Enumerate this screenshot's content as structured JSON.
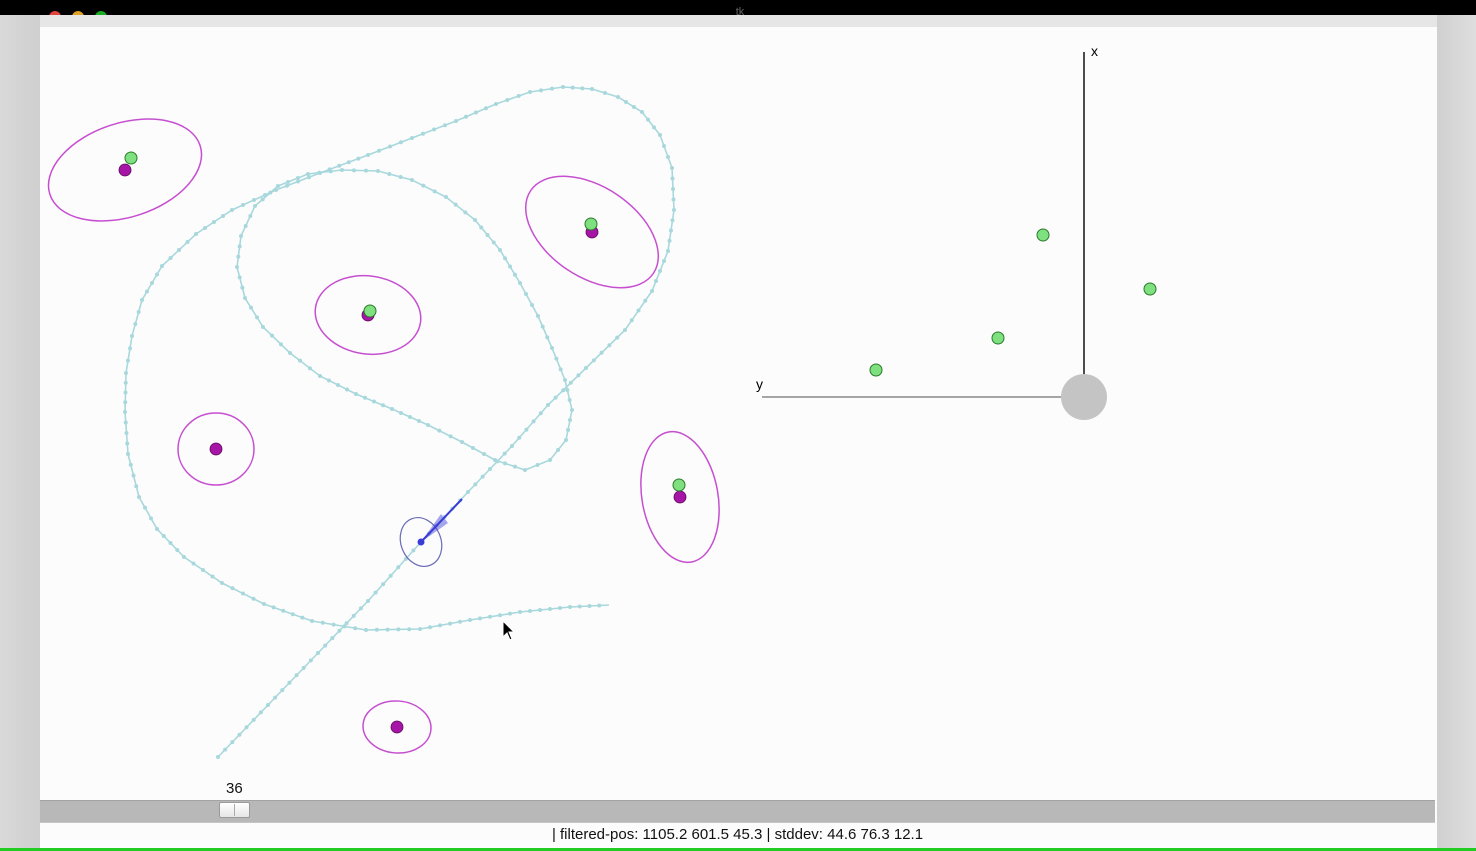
{
  "window": {
    "title": "tk"
  },
  "colors": {
    "ellipse": "#c64fd0",
    "landmark_true": "#7fe07f",
    "landmark_est": "#a615a6",
    "trajectory": "#a8d8dc",
    "robot": "#3b3bd6",
    "robot_ellipse": "#6a6ab8",
    "axis": "#111111",
    "axis_y": "#888888",
    "origin": "#c4c4c4"
  },
  "scene": {
    "landmarks": [
      {
        "true": [
          131,
          158
        ],
        "est": [
          125,
          170
        ],
        "ellipse": {
          "c": [
            125,
            170
          ],
          "rx": 79,
          "ry": 47,
          "rot": -18
        }
      },
      {
        "true": [
          591,
          224
        ],
        "est": [
          592,
          232
        ],
        "ellipse": {
          "c": [
            592,
            232
          ],
          "rx": 74,
          "ry": 45,
          "rot": 34
        }
      },
      {
        "true": [
          370,
          311
        ],
        "est": [
          368,
          315
        ],
        "ellipse": {
          "c": [
            368,
            315
          ],
          "rx": 53,
          "ry": 39,
          "rot": 8
        }
      },
      {
        "true": null,
        "est": [
          216,
          449
        ],
        "ellipse": {
          "c": [
            216,
            449
          ],
          "rx": 38,
          "ry": 36,
          "rot": 0
        }
      },
      {
        "true": [
          679,
          485
        ],
        "est": [
          680,
          497
        ],
        "ellipse": {
          "c": [
            680,
            497
          ],
          "rx": 38,
          "ry": 66,
          "rot": -10
        }
      },
      {
        "true": null,
        "est": [
          397,
          727
        ],
        "ellipse": {
          "c": [
            397,
            727
          ],
          "rx": 34,
          "ry": 26,
          "rot": 4
        }
      }
    ],
    "trajectory": [
      [
        218,
        757
      ],
      [
        268,
        705
      ],
      [
        318,
        653
      ],
      [
        368,
        601
      ],
      [
        421,
        542
      ],
      [
        468,
        492
      ],
      [
        512,
        446
      ],
      [
        548,
        405
      ],
      [
        586,
        368
      ],
      [
        625,
        330
      ],
      [
        652,
        291
      ],
      [
        668,
        251
      ],
      [
        674,
        210
      ],
      [
        672,
        168
      ],
      [
        660,
        135
      ],
      [
        642,
        112
      ],
      [
        618,
        97
      ],
      [
        592,
        89
      ],
      [
        563,
        87
      ],
      [
        530,
        92
      ],
      [
        496,
        104
      ],
      [
        456,
        121
      ],
      [
        412,
        138
      ],
      [
        368,
        155
      ],
      [
        320,
        173
      ],
      [
        276,
        190
      ],
      [
        232,
        210
      ],
      [
        196,
        234
      ],
      [
        162,
        266
      ],
      [
        142,
        300
      ],
      [
        132,
        336
      ],
      [
        126,
        373
      ],
      [
        125,
        412
      ],
      [
        128,
        454
      ],
      [
        139,
        497
      ],
      [
        157,
        529
      ],
      [
        184,
        557
      ],
      [
        222,
        583
      ],
      [
        264,
        604
      ],
      [
        312,
        621
      ],
      [
        366,
        630
      ],
      [
        420,
        629
      ],
      [
        470,
        620
      ],
      [
        520,
        612
      ],
      [
        570,
        607
      ],
      [
        609,
        605
      ]
    ],
    "trajectory2": [
      [
        565,
        380
      ],
      [
        572,
        410
      ],
      [
        566,
        440
      ],
      [
        550,
        460
      ],
      [
        525,
        470
      ],
      [
        495,
        460
      ],
      [
        462,
        442
      ],
      [
        428,
        425
      ],
      [
        392,
        409
      ],
      [
        356,
        394
      ],
      [
        320,
        376
      ],
      [
        290,
        353
      ],
      [
        263,
        327
      ],
      [
        245,
        298
      ],
      [
        237,
        267
      ],
      [
        241,
        236
      ],
      [
        255,
        206
      ],
      [
        278,
        186
      ],
      [
        308,
        174
      ],
      [
        342,
        170
      ],
      [
        378,
        171
      ],
      [
        412,
        180
      ],
      [
        446,
        197
      ],
      [
        475,
        220
      ],
      [
        500,
        250
      ],
      [
        520,
        283
      ],
      [
        538,
        316
      ],
      [
        552,
        348
      ],
      [
        565,
        380
      ]
    ],
    "robot": {
      "pos": [
        421,
        542
      ],
      "heading": [
        462,
        499
      ],
      "ellipse": {
        "rx": 20,
        "ry": 25,
        "rot": -22
      }
    },
    "plot_origin": [
      1084,
      397
    ],
    "plot_axis_x_top": [
      1084,
      52
    ],
    "plot_axis_y_left": [
      762,
      397
    ],
    "plot_points": [
      [
        1043,
        235
      ],
      [
        1150,
        289
      ],
      [
        998,
        338
      ],
      [
        876,
        370
      ]
    ],
    "cursor": [
      502,
      620
    ]
  },
  "axis_labels": {
    "x": "x",
    "y": "y"
  },
  "slider": {
    "value": "36",
    "min": 0,
    "max": 250,
    "fraction": 0.144
  },
  "status_text": "| filtered-pos: 1105.2 601.5 45.3 | stddev: 44.6 76.3 12.1"
}
